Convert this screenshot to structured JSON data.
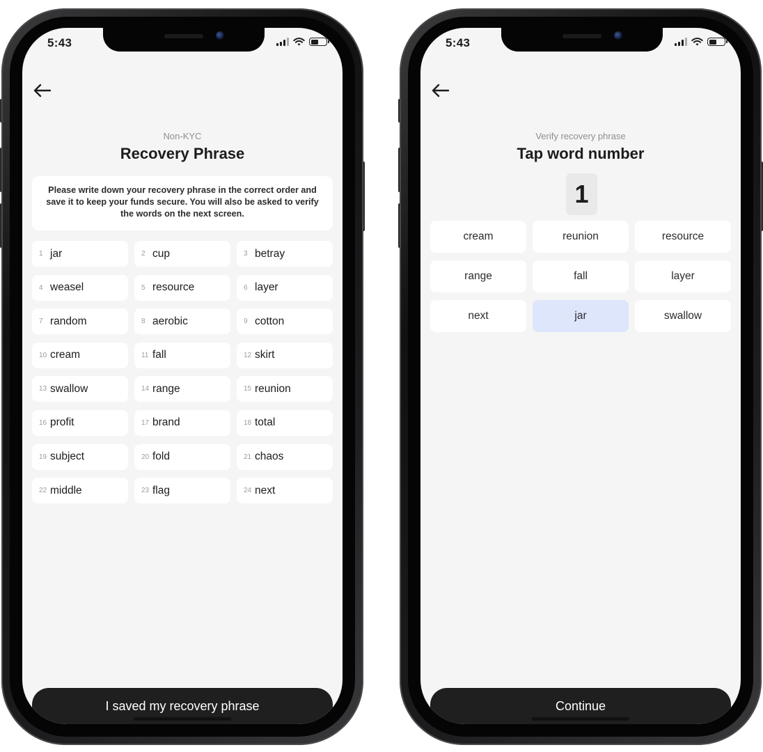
{
  "left_screen": {
    "status": {
      "time": "5:43"
    },
    "kicker": "Non-KYC",
    "title": "Recovery Phrase",
    "notice": "Please write down your recovery phrase in the correct order and save it to keep your funds secure. You will also be asked to verify the words on the next screen.",
    "words": [
      {
        "num": "1",
        "word": "jar"
      },
      {
        "num": "2",
        "word": "cup"
      },
      {
        "num": "3",
        "word": "betray"
      },
      {
        "num": "4",
        "word": "weasel"
      },
      {
        "num": "5",
        "word": "resource"
      },
      {
        "num": "6",
        "word": "layer"
      },
      {
        "num": "7",
        "word": "random"
      },
      {
        "num": "8",
        "word": "aerobic"
      },
      {
        "num": "9",
        "word": "cotton"
      },
      {
        "num": "10",
        "word": "cream"
      },
      {
        "num": "11",
        "word": "fall"
      },
      {
        "num": "12",
        "word": "skirt"
      },
      {
        "num": "13",
        "word": "swallow"
      },
      {
        "num": "14",
        "word": "range"
      },
      {
        "num": "15",
        "word": "reunion"
      },
      {
        "num": "16",
        "word": "profit"
      },
      {
        "num": "17",
        "word": "brand"
      },
      {
        "num": "18",
        "word": "total"
      },
      {
        "num": "19",
        "word": "subject"
      },
      {
        "num": "20",
        "word": "fold"
      },
      {
        "num": "21",
        "word": "chaos"
      },
      {
        "num": "22",
        "word": "middle"
      },
      {
        "num": "23",
        "word": "flag"
      },
      {
        "num": "24",
        "word": "next"
      }
    ],
    "button_label": "I saved my recovery phrase"
  },
  "right_screen": {
    "status": {
      "time": "5:43"
    },
    "kicker": "Verify recovery phrase",
    "title": "Tap word number",
    "word_number": "1",
    "choices": [
      "cream",
      "reunion",
      "resource",
      "range",
      "fall",
      "layer",
      "next",
      "jar",
      "swallow"
    ],
    "selected_choice": "jar",
    "selected_color": "#dde6fb",
    "button_label": "Continue"
  }
}
